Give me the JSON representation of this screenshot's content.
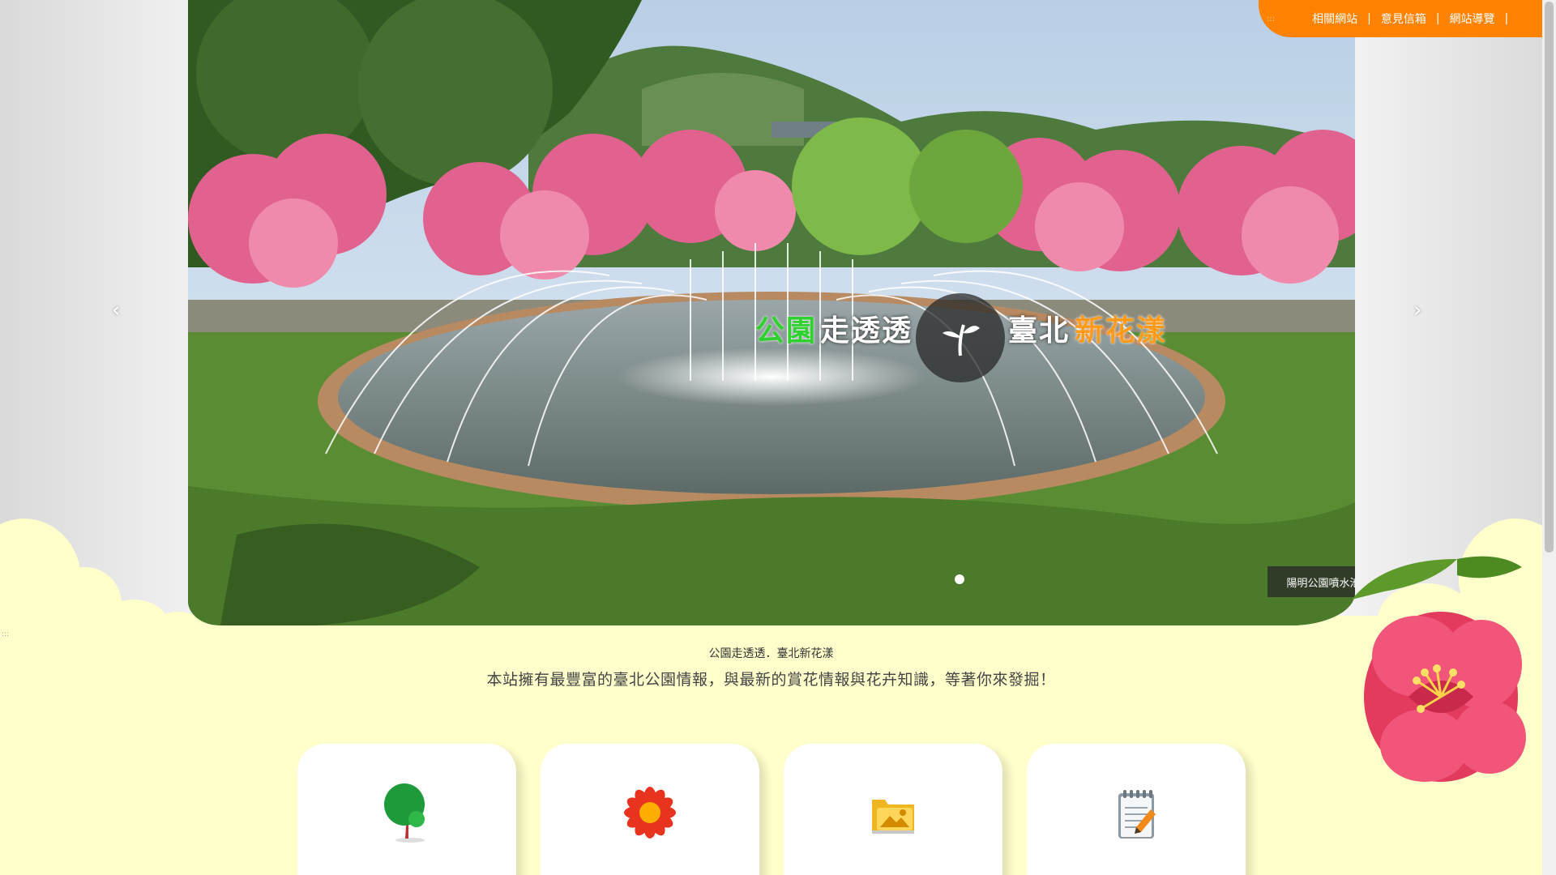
{
  "top_nav": {
    "dots": ":::",
    "links": [
      {
        "label": "相關網站"
      },
      {
        "label": "意見信箱"
      },
      {
        "label": "網站導覽"
      }
    ],
    "separator": "|"
  },
  "hero": {
    "prev_label": "‹",
    "next_label": "›",
    "logo": {
      "park_green": "公園",
      "park_white": "走透透",
      "taipei": "臺北",
      "flower": "新花漾"
    },
    "caption": "陽明公園噴水池",
    "slide_count": 1,
    "active_slide": 1
  },
  "side_dots": ":::",
  "intro": {
    "subtitle": "公園走透透．臺北新花漾",
    "description": "本站擁有最豐富的臺北公園情報，與最新的賞花情報與花卉知識，等著你來發掘！"
  },
  "cards": [
    {
      "icon": "tree-icon"
    },
    {
      "icon": "flower-icon"
    },
    {
      "icon": "photo-folder-icon"
    },
    {
      "icon": "notepad-pencil-icon"
    }
  ],
  "colors": {
    "accent_orange": "#ff8200",
    "page_background": "#ffffcc",
    "logo_green": "#2fd12f",
    "logo_orange": "#ff9a1a"
  }
}
